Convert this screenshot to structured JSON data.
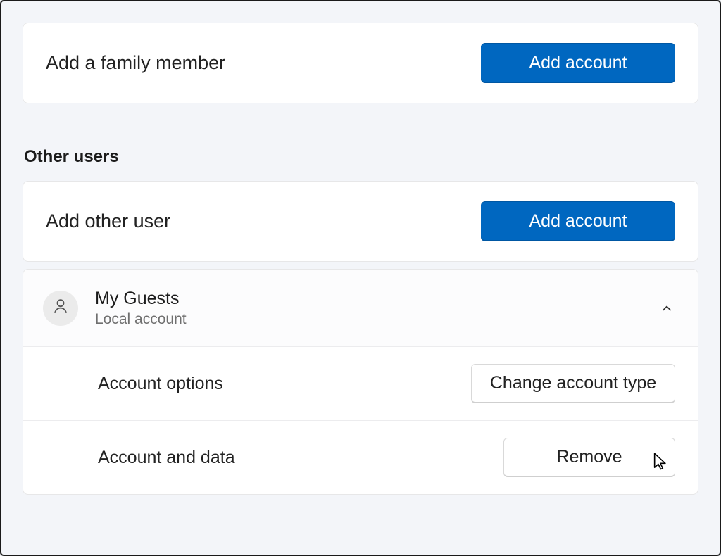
{
  "family": {
    "add_family_label": "Add a family member",
    "add_family_button": "Add account"
  },
  "other_users": {
    "heading": "Other users",
    "add_other_label": "Add other user",
    "add_other_button": "Add account",
    "user": {
      "name": "My Guests",
      "subtitle": "Local account",
      "options_label": "Account options",
      "options_button": "Change account type",
      "data_label": "Account and data",
      "remove_button": "Remove"
    }
  }
}
